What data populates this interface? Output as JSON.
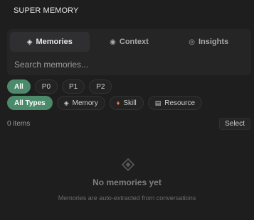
{
  "app": {
    "title": "SUPER MEMORY"
  },
  "tabs": [
    {
      "label": "Memories",
      "icon": "diamond-icon",
      "glyph": "◈",
      "active": true
    },
    {
      "label": "Context",
      "icon": "target-icon",
      "glyph": "◉",
      "active": false
    },
    {
      "label": "Insights",
      "icon": "ring-icon",
      "glyph": "◎",
      "active": false
    }
  ],
  "search": {
    "placeholder": "Search memories...",
    "value": ""
  },
  "priority_filters": [
    {
      "label": "All",
      "active": true
    },
    {
      "label": "P0",
      "active": false
    },
    {
      "label": "P1",
      "active": false
    },
    {
      "label": "P2",
      "active": false
    }
  ],
  "type_filters": [
    {
      "label": "All Types",
      "glyph": "",
      "icon": "",
      "active": true
    },
    {
      "label": "Memory",
      "glyph": "◈",
      "icon": "diamond-icon",
      "active": false
    },
    {
      "label": "Skill",
      "glyph": "♦",
      "icon": "flame-icon",
      "active": false
    },
    {
      "label": "Resource",
      "glyph": "▤",
      "icon": "document-icon",
      "active": false
    }
  ],
  "list": {
    "count_text": "0 items",
    "select_label": "Select"
  },
  "empty_state": {
    "icon": "diamond-outline-icon",
    "title": "No memories yet",
    "subtitle": "Memories are auto-extracted from conversations"
  },
  "colors": {
    "accent": "#4b8a6b",
    "background": "#1e1e1e",
    "panel": "#252526"
  }
}
